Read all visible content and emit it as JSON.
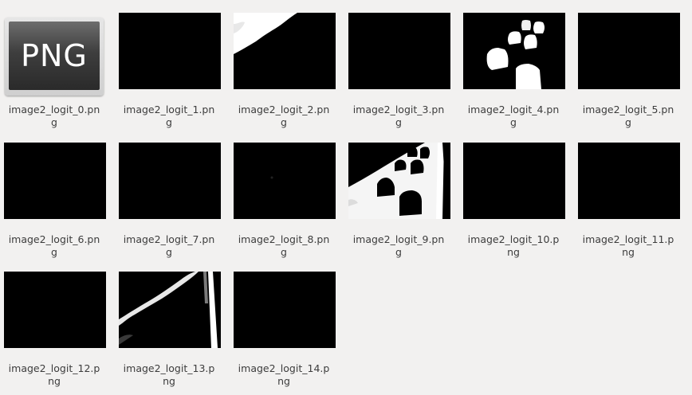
{
  "files": [
    {
      "name_line1": "image2_logit_0.pn",
      "name_line2": "g",
      "kind": "png-icon",
      "icon_text": "PNG"
    },
    {
      "name_line1": "image2_logit_1.pn",
      "name_line2": "g",
      "kind": "black"
    },
    {
      "name_line1": "image2_logit_2.pn",
      "name_line2": "g",
      "kind": "corner-white"
    },
    {
      "name_line1": "image2_logit_3.pn",
      "name_line2": "g",
      "kind": "black"
    },
    {
      "name_line1": "image2_logit_4.pn",
      "name_line2": "g",
      "kind": "cars-white"
    },
    {
      "name_line1": "image2_logit_5.pn",
      "name_line2": "g",
      "kind": "black"
    },
    {
      "name_line1": "image2_logit_6.pn",
      "name_line2": "g",
      "kind": "black"
    },
    {
      "name_line1": "image2_logit_7.pn",
      "name_line2": "g",
      "kind": "black"
    },
    {
      "name_line1": "image2_logit_8.pn",
      "name_line2": "g",
      "kind": "black"
    },
    {
      "name_line1": "image2_logit_9.pn",
      "name_line2": "g",
      "kind": "road-white"
    },
    {
      "name_line1": "image2_logit_10.p",
      "name_line2": "ng",
      "kind": "black"
    },
    {
      "name_line1": "image2_logit_11.p",
      "name_line2": "ng",
      "kind": "black"
    },
    {
      "name_line1": "image2_logit_12.p",
      "name_line2": "ng",
      "kind": "black"
    },
    {
      "name_line1": "image2_logit_13.p",
      "name_line2": "ng",
      "kind": "lines-white"
    },
    {
      "name_line1": "image2_logit_14.p",
      "name_line2": "ng",
      "kind": "black"
    }
  ]
}
